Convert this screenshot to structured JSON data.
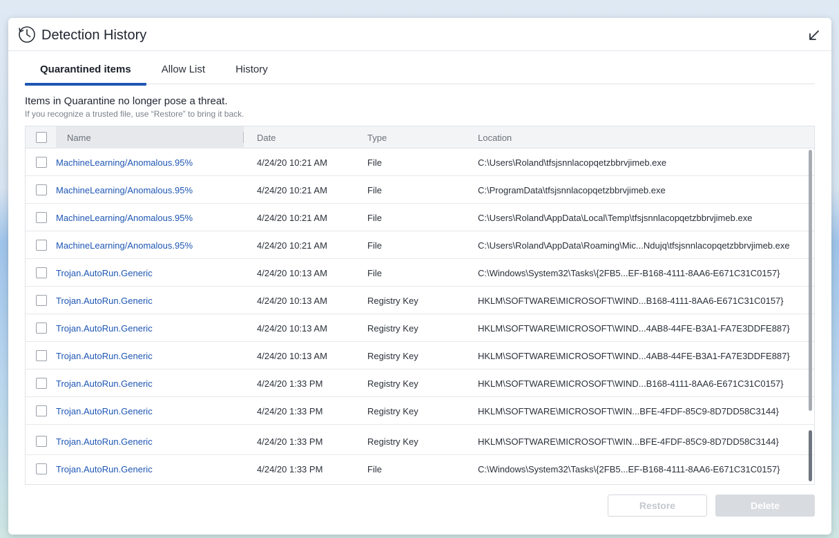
{
  "window": {
    "title": "Detection History"
  },
  "tabs": [
    {
      "label": "Quarantined items",
      "active": true
    },
    {
      "label": "Allow List",
      "active": false
    },
    {
      "label": "History",
      "active": false
    }
  ],
  "info": {
    "main": "Items in Quarantine no longer pose a threat.",
    "sub": "If you recognize a trusted file, use “Restore” to bring it back."
  },
  "table": {
    "columns": {
      "name": "Name",
      "date": "Date",
      "type": "Type",
      "location": "Location"
    },
    "rows": [
      {
        "name": "MachineLearning/Anomalous.95%",
        "date": "4/24/20 10:21 AM",
        "type": "File",
        "location": "C:\\Users\\Roland\\tfsjsnnlacopqetzbbrvjimeb.exe"
      },
      {
        "name": "MachineLearning/Anomalous.95%",
        "date": "4/24/20 10:21 AM",
        "type": "File",
        "location": "C:\\ProgramData\\tfsjsnnlacopqetzbbrvjimeb.exe"
      },
      {
        "name": "MachineLearning/Anomalous.95%",
        "date": "4/24/20 10:21 AM",
        "type": "File",
        "location": "C:\\Users\\Roland\\AppData\\Local\\Temp\\tfsjsnnlacopqetzbbrvjimeb.exe"
      },
      {
        "name": "MachineLearning/Anomalous.95%",
        "date": "4/24/20 10:21 AM",
        "type": "File",
        "location": "C:\\Users\\Roland\\AppData\\Roaming\\Mic...Ndujq\\tfsjsnnlacopqetzbbrvjimeb.exe"
      },
      {
        "name": "Trojan.AutoRun.Generic",
        "date": "4/24/20 10:13 AM",
        "type": "File",
        "location": "C:\\Windows\\System32\\Tasks\\{2FB5...EF-B168-4111-8AA6-E671C31C0157}"
      },
      {
        "name": "Trojan.AutoRun.Generic",
        "date": "4/24/20 10:13 AM",
        "type": "Registry Key",
        "location": "HKLM\\SOFTWARE\\MICROSOFT\\WIND...B168-4111-8AA6-E671C31C0157}"
      },
      {
        "name": "Trojan.AutoRun.Generic",
        "date": "4/24/20 10:13 AM",
        "type": "Registry Key",
        "location": "HKLM\\SOFTWARE\\MICROSOFT\\WIND...4AB8-44FE-B3A1-FA7E3DDFE887}"
      },
      {
        "name": "Trojan.AutoRun.Generic",
        "date": "4/24/20 10:13 AM",
        "type": "Registry Key",
        "location": "HKLM\\SOFTWARE\\MICROSOFT\\WIND...4AB8-44FE-B3A1-FA7E3DDFE887}"
      },
      {
        "name": "Trojan.AutoRun.Generic",
        "date": "4/24/20 1:33 PM",
        "type": "Registry Key",
        "location": "HKLM\\SOFTWARE\\MICROSOFT\\WIND...B168-4111-8AA6-E671C31C0157}"
      },
      {
        "name": "Trojan.AutoRun.Generic",
        "date": "4/24/20 1:33 PM",
        "type": "Registry Key",
        "location": "HKLM\\SOFTWARE\\MICROSOFT\\WIN...BFE-4FDF-85C9-8D7DD58C3144}"
      },
      {
        "name": "Trojan.AutoRun.Generic",
        "date": "4/24/20 1:33 PM",
        "type": "Registry Key",
        "location": "HKLM\\SOFTWARE\\MICROSOFT\\WIN...BFE-4FDF-85C9-8D7DD58C3144}"
      },
      {
        "name": "Trojan.AutoRun.Generic",
        "date": "4/24/20 1:33 PM",
        "type": "File",
        "location": "C:\\Windows\\System32\\Tasks\\{2FB5...EF-B168-4111-8AA6-E671C31C0157}"
      }
    ]
  },
  "buttons": {
    "restore": "Restore",
    "delete": "Delete"
  },
  "icons": {
    "title": "clock-history-icon",
    "minimize": "arrow-down-left-icon"
  },
  "colors": {
    "accent": "#1e56b4",
    "link": "#1e56b4"
  }
}
